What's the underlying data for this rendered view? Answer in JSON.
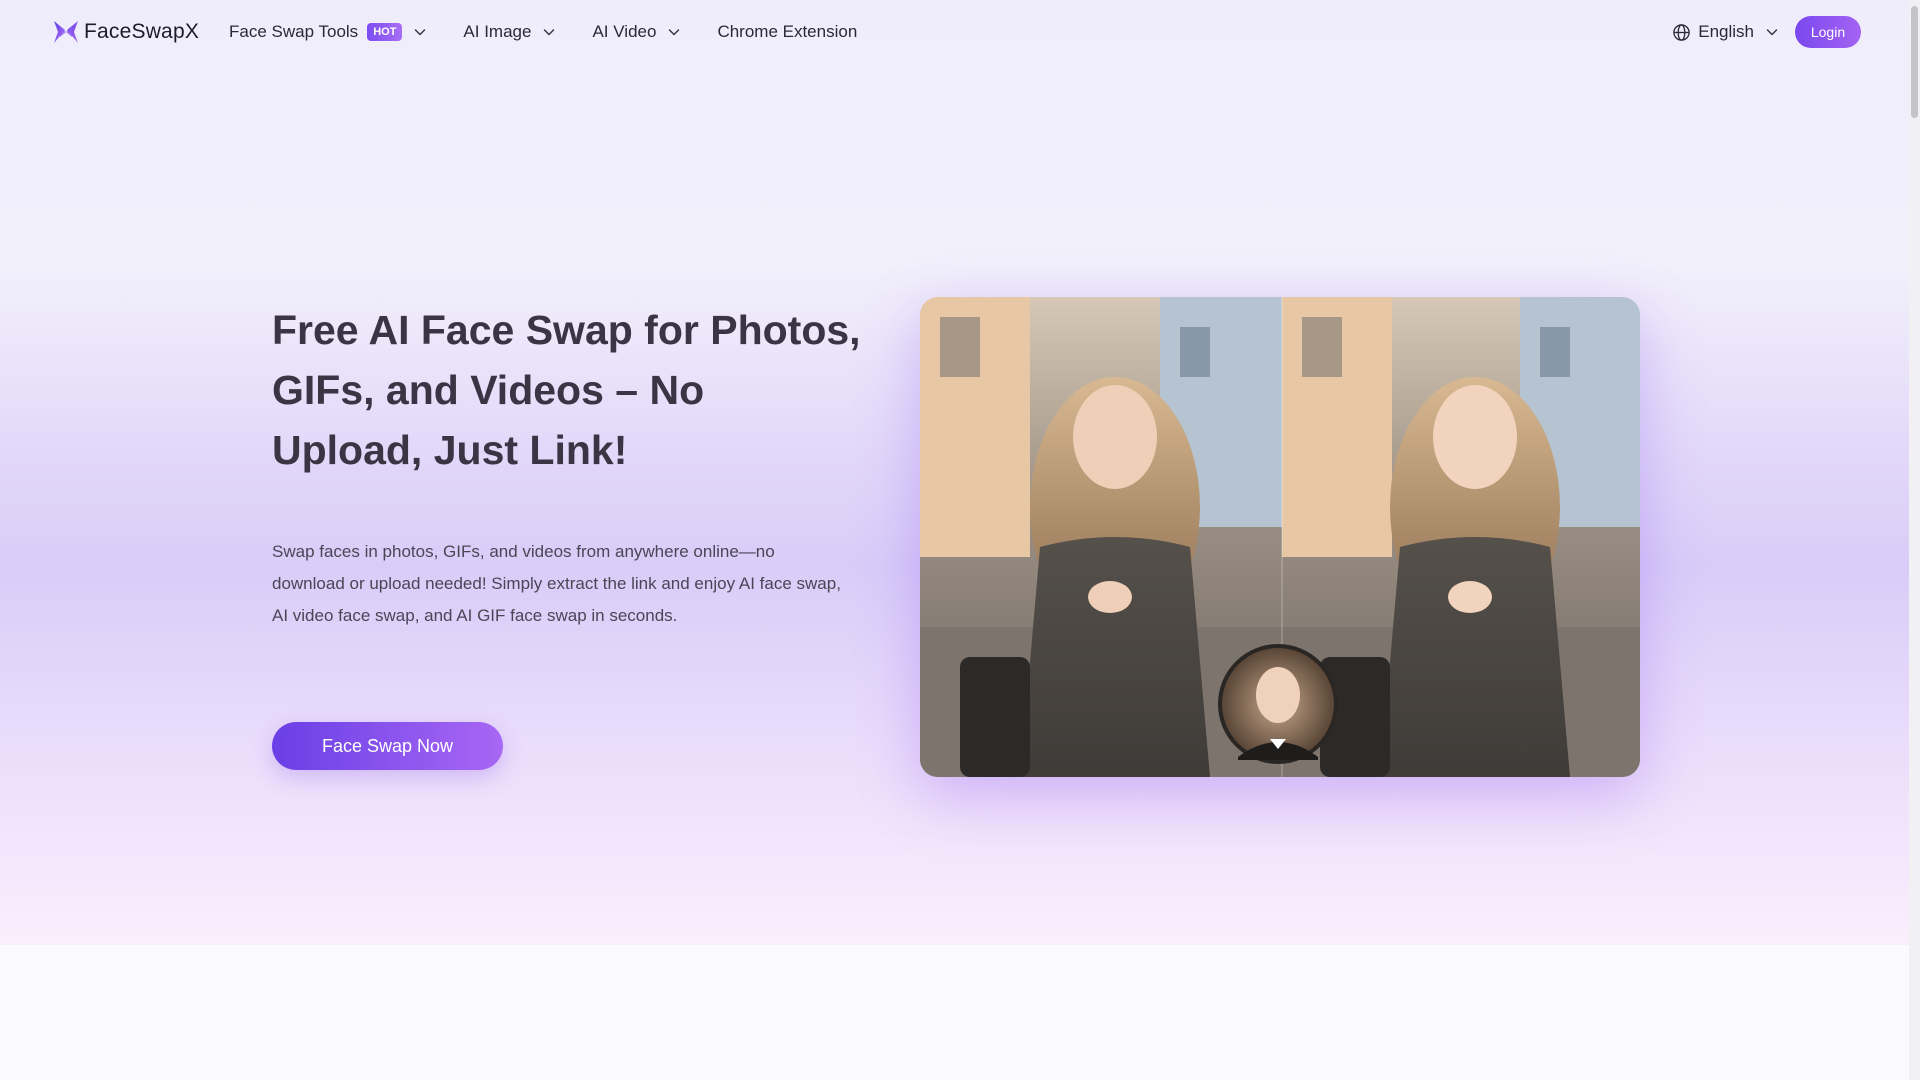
{
  "brand": {
    "name": "FaceSwapX",
    "accent": "#7b4df2",
    "accent_light": "#a86ef5"
  },
  "nav": {
    "items": [
      {
        "label": "Face Swap Tools",
        "badge": "HOT",
        "has_dropdown": true,
        "icon": "chevron-down-icon"
      },
      {
        "label": "AI Image",
        "has_dropdown": true,
        "icon": "chevron-down-icon"
      },
      {
        "label": "AI Video",
        "has_dropdown": true,
        "icon": "chevron-down-icon"
      },
      {
        "label": "Chrome Extension",
        "has_dropdown": false
      }
    ],
    "language": {
      "label": "English",
      "icon": "globe-icon",
      "dropdown_icon": "chevron-down-icon"
    },
    "login_label": "Login"
  },
  "hero": {
    "title": "Free AI Face Swap for Photos, GIFs, and Videos – No Upload, Just Link!",
    "description": "Swap faces in photos, GIFs, and videos from anywhere online—no download or upload needed! Simply extract the link and enjoy AI face swap, AI video face swap, and AI GIF face swap in seconds.",
    "cta_label": "Face Swap Now",
    "image": {
      "panels": [
        "original-photo",
        "swapped-photo"
      ],
      "overlay": "source-face-avatar"
    }
  }
}
